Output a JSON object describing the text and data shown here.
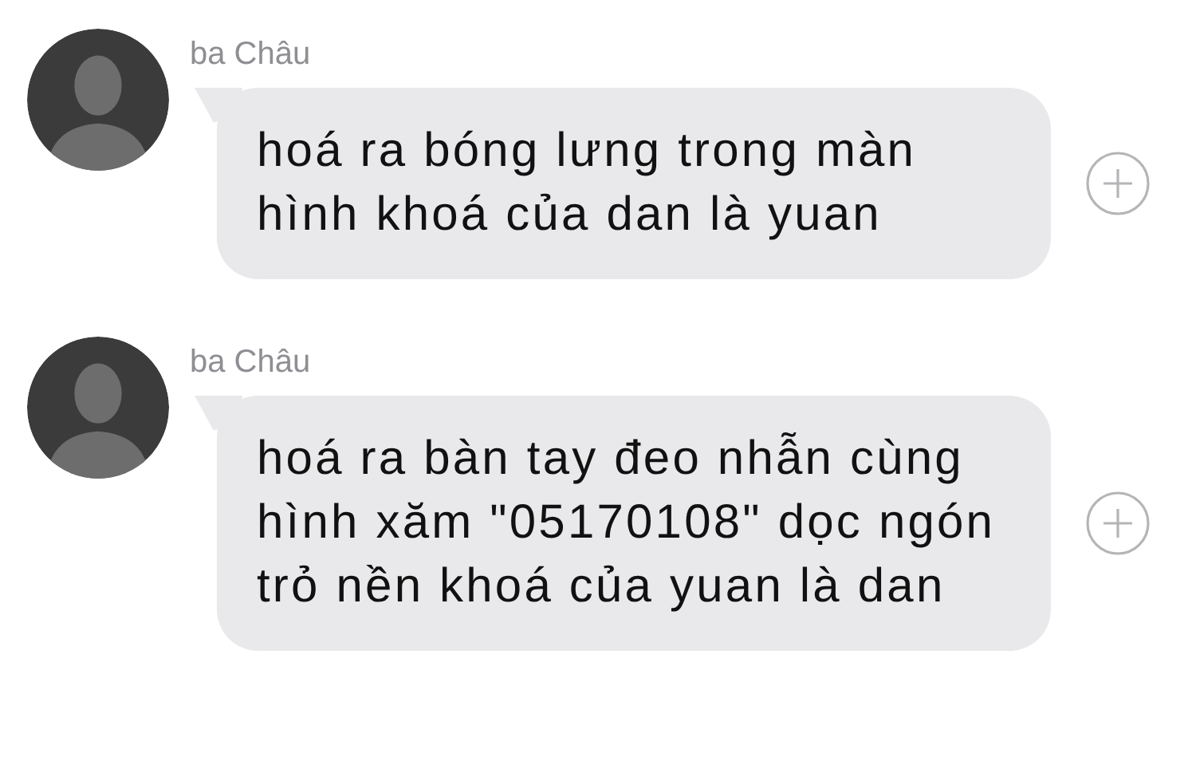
{
  "messages": [
    {
      "sender": "ba Châu",
      "text": "hoá ra bóng lưng trong màn hình khoá của dan là yuan"
    },
    {
      "sender": "ba Châu",
      "text": "hoá ra bàn tay đeo nhẫn cùng hình xăm \"05170108\" dọc ngón trỏ nền khoá của yuan là dan"
    }
  ]
}
